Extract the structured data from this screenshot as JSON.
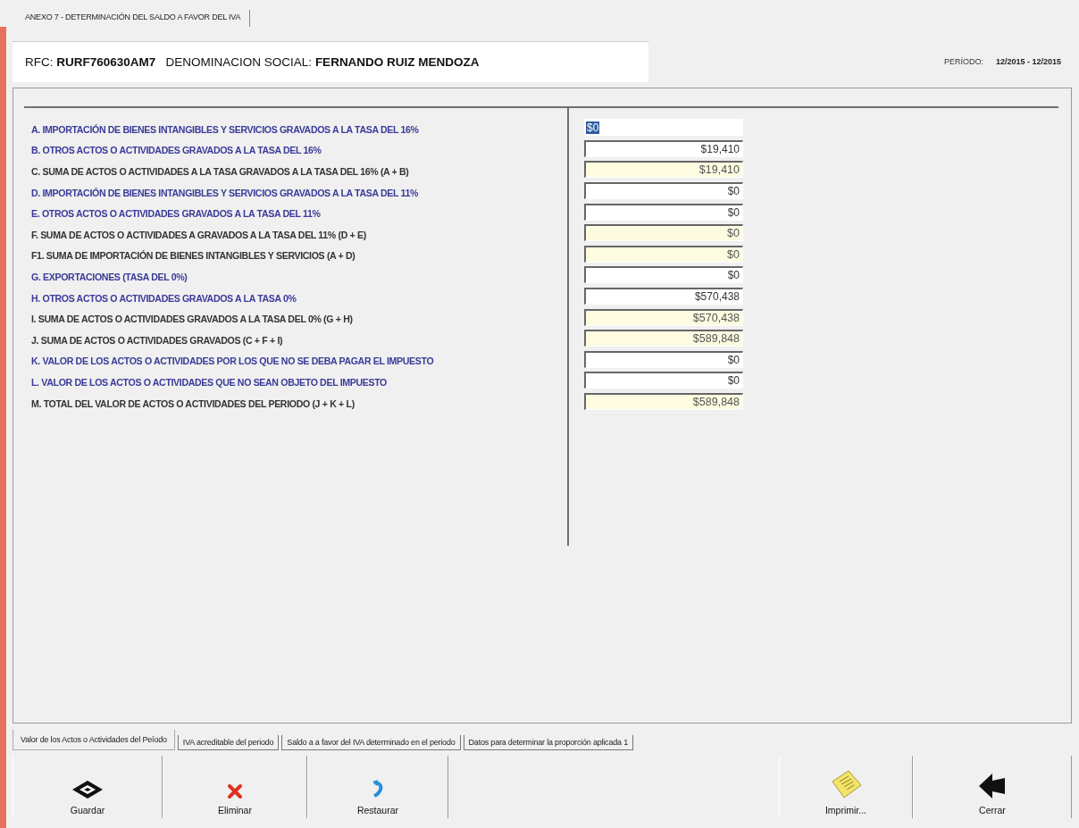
{
  "window_tab": {
    "label": "ANEXO 7 - DETERMINACIÓN DEL SALDO A FAVOR DEL IVA",
    "selected": true
  },
  "header": {
    "rfc_label": "RFC:",
    "rfc": "RURF760630AM7",
    "name_label": "DENOMINACION SOCIAL:",
    "name": "FERNANDO RUIZ  MENDOZA",
    "period_label": "PERÍODO:",
    "period": "12/2015 - 12/2015"
  },
  "rows": [
    {
      "label": "A. IMPORTACIÓN DE BIENES INTANGIBLES Y SERVICIOS GRAVADOS A LA TASA DEL 16%",
      "value": "$0",
      "kind": "input",
      "focused": true
    },
    {
      "label": "B. OTROS ACTOS O ACTIVIDADES GRAVADOS A LA TASA DEL 16%",
      "value": "$19,410",
      "kind": "input",
      "focused": false
    },
    {
      "label": "C. SUMA DE ACTOS O ACTIVIDADES A LA TASA GRAVADOS A LA TASA DEL 16% (A + B)",
      "value": "$19,410",
      "kind": "computed",
      "focused": false
    },
    {
      "label": "D. IMPORTACIÓN DE BIENES INTANGIBLES Y SERVICIOS GRAVADOS A LA TASA DEL 11%",
      "value": "$0",
      "kind": "input",
      "focused": false
    },
    {
      "label": "E. OTROS ACTOS O ACTIVIDADES GRAVADOS A LA TASA DEL 11%",
      "value": "$0",
      "kind": "input",
      "focused": false
    },
    {
      "label": "F. SUMA DE ACTOS O ACTIVIDADES A GRAVADOS A LA TASA DEL 11% (D + E)",
      "value": "$0",
      "kind": "computed",
      "focused": false
    },
    {
      "label": "F1. SUMA DE IMPORTACIÓN DE BIENES INTANGIBLES Y SERVICIOS (A + D)",
      "value": "$0",
      "kind": "computed",
      "focused": false
    },
    {
      "label": "G. EXPORTACIONES (TASA DEL 0%)",
      "value": "$0",
      "kind": "input",
      "focused": false
    },
    {
      "label": "H. OTROS ACTOS O ACTIVIDADES GRAVADOS A LA TASA 0%",
      "value": "$570,438",
      "kind": "input",
      "focused": false
    },
    {
      "label": "I. SUMA DE ACTOS O ACTIVIDADES GRAVADOS A LA TASA DEL 0% (G + H)",
      "value": "$570,438",
      "kind": "computed",
      "focused": false
    },
    {
      "label": "J. SUMA DE ACTOS O ACTIVIDADES GRAVADOS (C + F + I)",
      "value": "$589,848",
      "kind": "computed",
      "focused": false
    },
    {
      "label": "K. VALOR DE LOS ACTOS O ACTIVIDADES POR LOS QUE NO SE DEBA PAGAR EL IMPUESTO",
      "value": "$0",
      "kind": "input",
      "focused": false
    },
    {
      "label": "L. VALOR DE LOS ACTOS O ACTIVIDADES QUE NO SEAN OBJETO DEL IMPUESTO",
      "value": "$0",
      "kind": "input",
      "focused": false
    },
    {
      "label": "M. TOTAL DEL VALOR DE ACTOS O ACTIVIDADES DEL PERIODO (J + K + L)",
      "value": "$589,848",
      "kind": "computed",
      "focused": false
    }
  ],
  "tabs": [
    {
      "label": "Valor de los Actos o Actividades del Peíodo",
      "selected": true
    },
    {
      "label": "IVA acreditable del periodo",
      "selected": false
    },
    {
      "label": "Saldo a a favor del IVA determinado en el periodo",
      "selected": false
    },
    {
      "label": "Datos para determinar la proporción aplicada 1",
      "selected": false
    }
  ],
  "buttons": [
    {
      "label": "Guardar",
      "kind": "save"
    },
    {
      "label": "Eliminar",
      "kind": "delete"
    },
    {
      "label": "Restaurar",
      "kind": "restore"
    },
    {
      "label": "Imprimir...",
      "kind": "print"
    },
    {
      "label": "Cerrar",
      "kind": "close"
    }
  ]
}
